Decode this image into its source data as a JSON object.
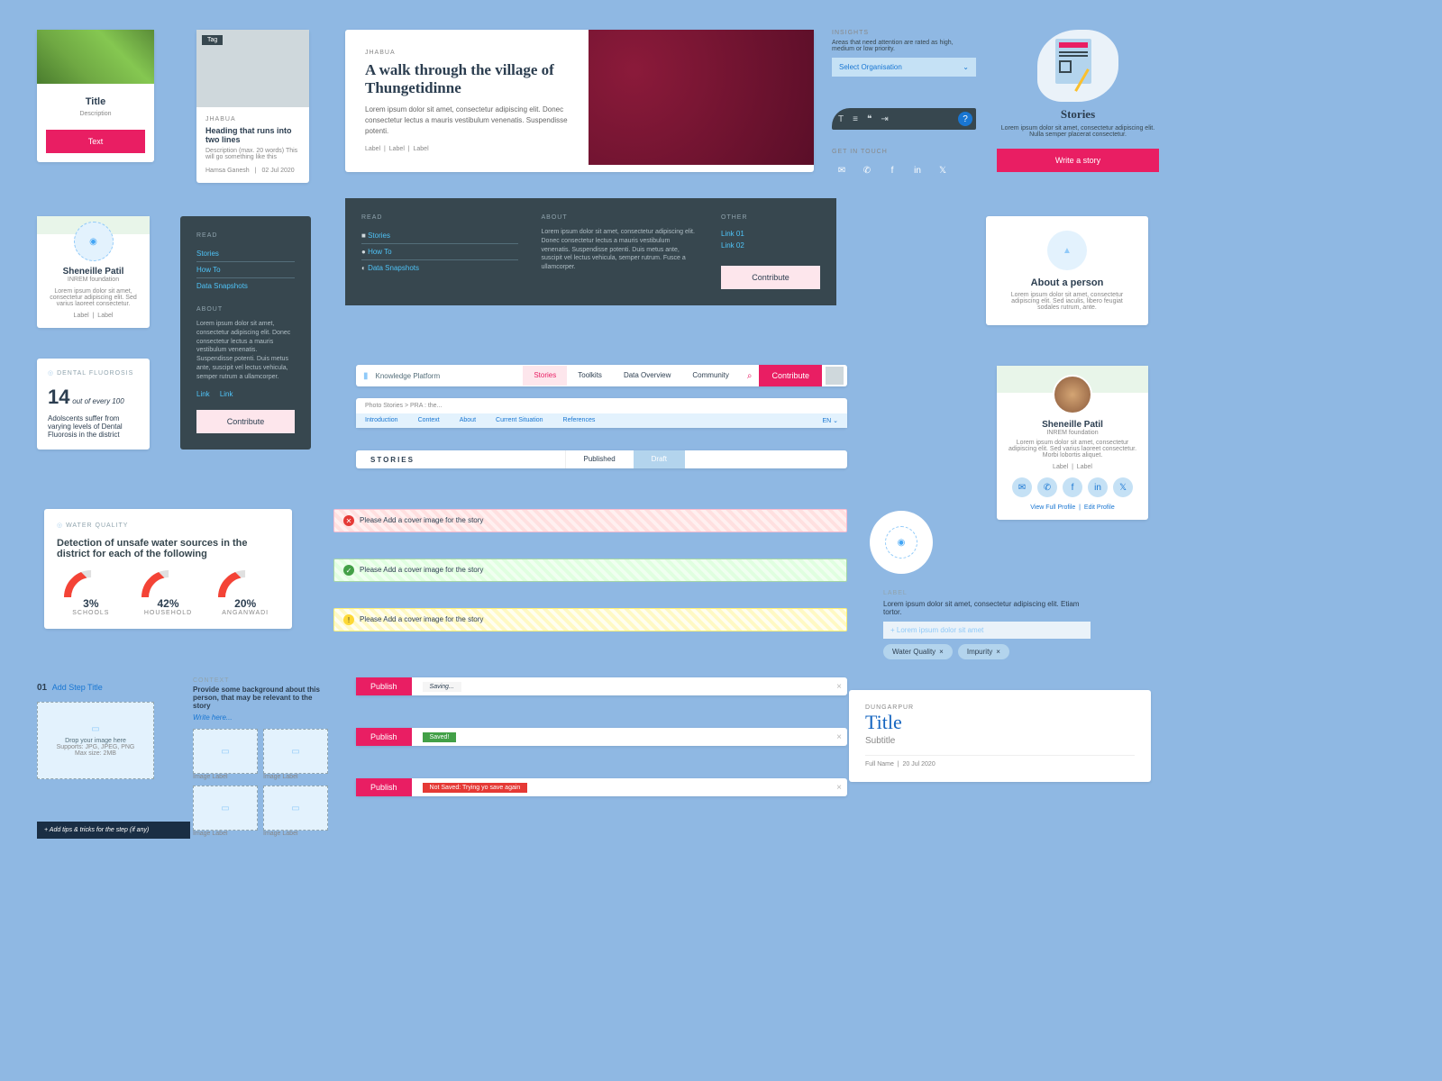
{
  "card1": {
    "title": "Title",
    "desc": "Description",
    "btn": "Text"
  },
  "card2": {
    "tag": "Tag",
    "loc": "JHABUA",
    "heading": "Heading that runs into two lines",
    "desc": "Description (max. 20 words) This will go something like this",
    "author": "Hamsa Ganesh",
    "date": "02 Jul 2020"
  },
  "article": {
    "loc": "JHABUA",
    "title": "A walk through the village of Thungetidinne",
    "body": "Lorem ipsum dolor sit amet, consectetur adipiscing elit. Donec consectetur lectus a mauris vestibulum venenatis. Suspendisse potenti.",
    "l1": "Label",
    "l2": "Label",
    "l3": "Label"
  },
  "insights": {
    "title": "INSIGHTS",
    "hint": "Areas that need attention are rated as high, medium or low priority.",
    "dropdown": "Select Organisation"
  },
  "stories_card": {
    "title": "Stories",
    "desc": "Lorem ipsum dolor sit amet, consectetur adipiscing elit. Nulla semper placerat consectetur.",
    "btn": "Write a story"
  },
  "profile1": {
    "name": "Sheneille Patil",
    "org": "INREM foundation",
    "bio": "Lorem ipsum dolor sit amet, consectetur adipiscing elit. Sed varius laoreet consectetur.",
    "l1": "Label",
    "l2": "Label"
  },
  "side_dark": {
    "sec": "READ",
    "s1": "Stories",
    "s2": "How To",
    "s3": "Data Snapshots",
    "about_h": "ABOUT",
    "about": "Lorem ipsum dolor sit amet, consectetur adipiscing elit. Donec consectetur lectus a mauris vestibulum venenatis. Suspendisse potenti. Duis metus ante, suscipit vel lectus vehicula, semper rutrum a ullamcorper.",
    "l1": "Link",
    "l2": "Link",
    "btn": "Contribute"
  },
  "footer": {
    "read": "READ",
    "about": "ABOUT",
    "other": "OTHER",
    "s1": "Stories",
    "s2": "How To",
    "s3": "Data Snapshots",
    "body": "Lorem ipsum dolor sit amet, consectetur adipiscing elit. Donec consectetur lectus a mauris vestibulum venenatis. Suspendisse potenti. Duis metus ante, suscipit vel lectus vehicula, semper rutrum. Fusce a ullamcorper.",
    "o1": "Link 01",
    "o2": "Link 02",
    "btn": "Contribute"
  },
  "stat": {
    "label": "DENTAL FLUOROSIS",
    "num": "14",
    "of": "out of every 100",
    "line": "Adolscents suffer from varying levels of Dental Fluorosis in the district"
  },
  "topnav": {
    "brand": "Knowledge Platform",
    "n1": "Stories",
    "n2": "Toolkits",
    "n3": "Data Overview",
    "n4": "Community",
    "btn": "Contribute"
  },
  "crumb": {
    "path": "Photo Stories > PRA : the...",
    "t1": "Introduction",
    "t2": "Context",
    "t3": "About",
    "t4": "Current Situation",
    "t5": "References",
    "lang": "EN"
  },
  "tabs": {
    "h": "STORIES",
    "t1": "Published",
    "t2": "Draft"
  },
  "about_person": {
    "title": "About a person",
    "body": "Lorem ipsum dolor sit amet, consectetur adipiscing elit. Sed iaculis, libero feugiat sodales rutrum, ante."
  },
  "water": {
    "label": "WATER QUALITY",
    "title": "Detection of unsafe water sources in the district for each of the following",
    "g1v": "3%",
    "g1l": "SCHOOLS",
    "g2v": "42%",
    "g2l": "HOUSEHOLD",
    "g3v": "20%",
    "g3l": "ANGANWADI"
  },
  "alerts": {
    "m": "Please Add a cover image for the story"
  },
  "touch": {
    "t": "GET IN TOUCH"
  },
  "profile2": {
    "name": "Sheneille Patil",
    "org": "INREM foundation",
    "bio": "Lorem ipsum dolor sit amet, consectetur adipiscing elit. Sed varius laoreet consectetur. Morbi lobortis aliquet.",
    "l1": "Label",
    "l2": "Label",
    "v": "View Full Profile",
    "e": "Edit Profile"
  },
  "tag_input": {
    "label": "LABEL",
    "hint": "Lorem ipsum dolor sit amet, consectetur adipiscing elit. Etiam tortor.",
    "ph": "Lorem ipsum dolor sit amet",
    "t1": "Water Quality",
    "t2": "Impurity"
  },
  "step": {
    "num": "01",
    "title": "Add Step Title",
    "drop": "Drop your image here",
    "sup": "Supports: JPG, JPEG, PNG",
    "max": "Max size: 2MB",
    "tips": "+ Add tips & tricks for the step (if any)"
  },
  "context": {
    "label": "CONTEXT",
    "hint": "Provide some background about this person, that may be relevant to the story",
    "ph": "Write here...",
    "il": "Image Label"
  },
  "publish": {
    "btn": "Publish",
    "saving": "Saving...",
    "saved": "Saved!",
    "err": "Not Saved: Trying yo save again"
  },
  "title_card": {
    "loc": "DUNGARPUR",
    "title": "Title",
    "sub": "Subtitle",
    "author": "Full Name",
    "date": "20 Jul 2020"
  }
}
